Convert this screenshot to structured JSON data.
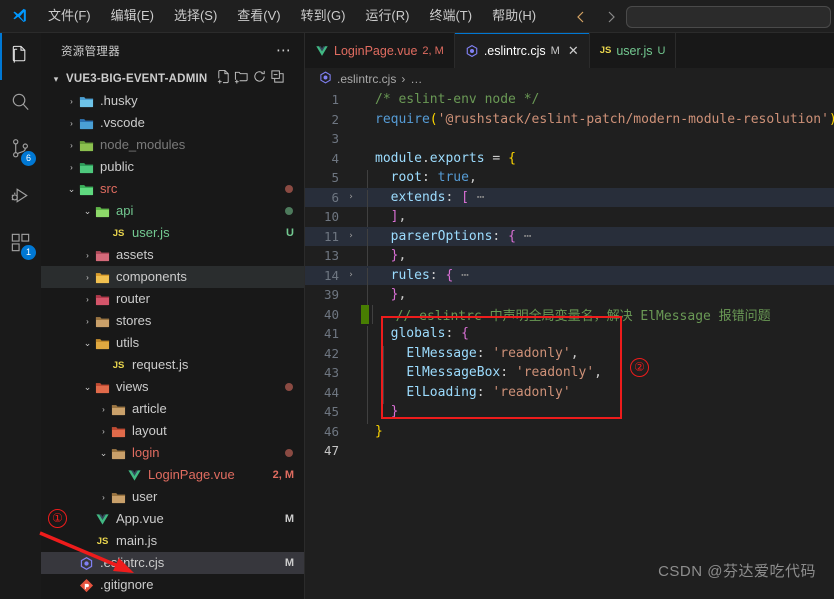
{
  "window": {
    "menu": [
      {
        "label": "文件(F)"
      },
      {
        "label": "编辑(E)"
      },
      {
        "label": "选择(S)"
      },
      {
        "label": "查看(V)"
      },
      {
        "label": "转到(G)"
      },
      {
        "label": "运行(R)"
      },
      {
        "label": "终端(T)"
      },
      {
        "label": "帮助(H)"
      }
    ],
    "command_center_placeholder": ""
  },
  "activity_bar": {
    "items": [
      {
        "name": "explorer",
        "icon": "files-icon",
        "badge": "",
        "active": true
      },
      {
        "name": "search",
        "icon": "search-icon",
        "badge": "",
        "active": false
      },
      {
        "name": "source-control",
        "icon": "source-control-icon",
        "badge": "6",
        "active": false
      },
      {
        "name": "run-debug",
        "icon": "run-debug-icon",
        "badge": "",
        "active": false
      },
      {
        "name": "extensions",
        "icon": "extensions-icon",
        "badge": "1",
        "active": false
      }
    ]
  },
  "sidebar": {
    "title": "资源管理器",
    "root": {
      "label": "VUE3-BIG-EVENT-ADMIN",
      "actions": [
        "new-file-icon",
        "new-folder-icon",
        "refresh-icon",
        "collapse-all-icon"
      ]
    },
    "tree": [
      {
        "label": ".husky",
        "indent": 1,
        "type": "folder",
        "chev": "collapsed",
        "icon": "husky",
        "color": "#cccccc",
        "mark": "",
        "dot": ""
      },
      {
        "label": ".vscode",
        "indent": 1,
        "type": "folder",
        "chev": "collapsed",
        "icon": "vscode",
        "color": "#cccccc",
        "mark": "",
        "dot": ""
      },
      {
        "label": "node_modules",
        "indent": 1,
        "type": "folder",
        "chev": "collapsed",
        "icon": "node",
        "color": "#7a7a7a",
        "mark": "",
        "dot": ""
      },
      {
        "label": "public",
        "indent": 1,
        "type": "folder",
        "chev": "collapsed",
        "icon": "public",
        "color": "#cccccc",
        "mark": "",
        "dot": ""
      },
      {
        "label": "src",
        "indent": 1,
        "type": "folder",
        "chev": "expanded",
        "icon": "src",
        "color": "#e06c60",
        "mark": "",
        "dot": "#8a4a42"
      },
      {
        "label": "api",
        "indent": 2,
        "type": "folder",
        "chev": "expanded",
        "icon": "api",
        "color": "#73c991",
        "mark": "",
        "dot": "#4d7a5c"
      },
      {
        "label": "user.js",
        "indent": 3,
        "type": "js",
        "chev": "none",
        "icon": "js",
        "color": "#73c991",
        "mark": "U",
        "markColor": "#73c991",
        "dot": ""
      },
      {
        "label": "assets",
        "indent": 2,
        "type": "folder",
        "chev": "collapsed",
        "icon": "assets",
        "color": "#cccccc",
        "mark": "",
        "dot": ""
      },
      {
        "label": "components",
        "indent": 2,
        "type": "folder",
        "chev": "collapsed",
        "icon": "components",
        "color": "#cccccc",
        "mark": "",
        "dot": "",
        "state": "hovered"
      },
      {
        "label": "router",
        "indent": 2,
        "type": "folder",
        "chev": "collapsed",
        "icon": "router",
        "color": "#cccccc",
        "mark": "",
        "dot": ""
      },
      {
        "label": "stores",
        "indent": 2,
        "type": "folder",
        "chev": "collapsed",
        "icon": "plain",
        "color": "#cccccc",
        "mark": "",
        "dot": ""
      },
      {
        "label": "utils",
        "indent": 2,
        "type": "folder",
        "chev": "expanded",
        "icon": "utils",
        "color": "#cccccc",
        "mark": "",
        "dot": ""
      },
      {
        "label": "request.js",
        "indent": 3,
        "type": "js",
        "chev": "none",
        "icon": "js",
        "color": "#cccccc",
        "mark": "",
        "dot": ""
      },
      {
        "label": "views",
        "indent": 2,
        "type": "folder",
        "chev": "expanded",
        "icon": "views",
        "color": "#cccccc",
        "mark": "",
        "dot": "#8a4a42"
      },
      {
        "label": "article",
        "indent": 3,
        "type": "folder",
        "chev": "collapsed",
        "icon": "plain",
        "color": "#cccccc",
        "mark": "",
        "dot": ""
      },
      {
        "label": "layout",
        "indent": 3,
        "type": "folder",
        "chev": "collapsed",
        "icon": "views",
        "color": "#cccccc",
        "mark": "",
        "dot": ""
      },
      {
        "label": "login",
        "indent": 3,
        "type": "folder",
        "chev": "expanded",
        "icon": "plain",
        "color": "#e06c60",
        "mark": "",
        "dot": "#8a4a42"
      },
      {
        "label": "LoginPage.vue",
        "indent": 4,
        "type": "vue",
        "chev": "none",
        "icon": "vue",
        "color": "#e06c60",
        "mark": "2, M",
        "markColor": "#e06c60",
        "dot": ""
      },
      {
        "label": "user",
        "indent": 3,
        "type": "folder",
        "chev": "collapsed",
        "icon": "plain",
        "color": "#cccccc",
        "mark": "",
        "dot": ""
      },
      {
        "label": "App.vue",
        "indent": 2,
        "type": "vue",
        "chev": "none",
        "icon": "vue",
        "color": "#cccccc",
        "mark": "M",
        "markColor": "#cccccc",
        "dot": ""
      },
      {
        "label": "main.js",
        "indent": 2,
        "type": "js",
        "chev": "none",
        "icon": "js",
        "color": "#cccccc",
        "mark": "",
        "dot": ""
      },
      {
        "label": ".eslintrc.cjs",
        "indent": 1,
        "type": "eslint",
        "chev": "none",
        "icon": "eslint",
        "color": "#cccccc",
        "mark": "M",
        "markColor": "#cccccc",
        "dot": "",
        "state": "selected"
      },
      {
        "label": ".gitignore",
        "indent": 1,
        "type": "git",
        "chev": "none",
        "icon": "git",
        "color": "#cccccc",
        "mark": "",
        "dot": ""
      }
    ]
  },
  "tabs": [
    {
      "label": "LoginPage.vue",
      "icon": "vue-icon",
      "mark": "2, M",
      "active": false,
      "closable": false,
      "color": "#e06c60"
    },
    {
      "label": ".eslintrc.cjs",
      "icon": "eslint-icon",
      "mark": "M",
      "active": true,
      "closable": true,
      "color": "#ffffff"
    },
    {
      "label": "user.js",
      "icon": "js-icon",
      "mark": "U",
      "active": false,
      "closable": false,
      "color": "#73c991"
    }
  ],
  "breadcrumb": {
    "icon": "eslint-icon",
    "file": ".eslintrc.cjs",
    "separator": "›",
    "more": "…"
  },
  "editor": {
    "lines": [
      {
        "num": "1",
        "fold": "",
        "modified": false,
        "folded": false,
        "indent": 0,
        "tokens": [
          {
            "t": "/* eslint-env node */",
            "c": "t-comment"
          }
        ]
      },
      {
        "num": "2",
        "fold": "",
        "modified": false,
        "folded": false,
        "indent": 0,
        "tokens": [
          {
            "t": "require",
            "c": "t-fn"
          },
          {
            "t": "(",
            "c": "t-paren"
          },
          {
            "t": "'@rushstack/eslint-patch/modern-module-resolution'",
            "c": "t-str"
          },
          {
            "t": ")",
            "c": "t-paren"
          }
        ]
      },
      {
        "num": "3",
        "fold": "",
        "modified": false,
        "folded": false,
        "indent": 0,
        "tokens": []
      },
      {
        "num": "4",
        "fold": "",
        "modified": false,
        "folded": false,
        "indent": 0,
        "tokens": [
          {
            "t": "module",
            "c": "t-obj"
          },
          {
            "t": ".",
            "c": "t-punct"
          },
          {
            "t": "exports",
            "c": "t-obj"
          },
          {
            "t": " = ",
            "c": "t-punct"
          },
          {
            "t": "{",
            "c": "t-paren"
          }
        ]
      },
      {
        "num": "5",
        "fold": "",
        "modified": false,
        "folded": false,
        "indent": 1,
        "tokens": [
          {
            "t": "  ",
            "c": ""
          },
          {
            "t": "root",
            "c": "t-prop"
          },
          {
            "t": ": ",
            "c": "t-punct"
          },
          {
            "t": "true",
            "c": "t-kw"
          },
          {
            "t": ",",
            "c": "t-punct"
          }
        ]
      },
      {
        "num": "6",
        "fold": "›",
        "modified": false,
        "folded": true,
        "indent": 1,
        "tokens": [
          {
            "t": "  ",
            "c": ""
          },
          {
            "t": "extends",
            "c": "t-prop"
          },
          {
            "t": ": ",
            "c": "t-punct"
          },
          {
            "t": "[",
            "c": "t-paren2"
          },
          {
            "t": " ⋯",
            "c": "t-dots"
          }
        ]
      },
      {
        "num": "10",
        "fold": "",
        "modified": false,
        "folded": false,
        "indent": 1,
        "tokens": [
          {
            "t": "  ",
            "c": ""
          },
          {
            "t": "]",
            "c": "t-paren2"
          },
          {
            "t": ",",
            "c": "t-punct"
          }
        ]
      },
      {
        "num": "11",
        "fold": "›",
        "modified": false,
        "folded": true,
        "indent": 1,
        "tokens": [
          {
            "t": "  ",
            "c": ""
          },
          {
            "t": "parserOptions",
            "c": "t-prop"
          },
          {
            "t": ": ",
            "c": "t-punct"
          },
          {
            "t": "{",
            "c": "t-paren2"
          },
          {
            "t": " ⋯",
            "c": "t-dots"
          }
        ]
      },
      {
        "num": "13",
        "fold": "",
        "modified": false,
        "folded": false,
        "indent": 1,
        "tokens": [
          {
            "t": "  ",
            "c": ""
          },
          {
            "t": "}",
            "c": "t-paren2"
          },
          {
            "t": ",",
            "c": "t-punct"
          }
        ]
      },
      {
        "num": "14",
        "fold": "›",
        "modified": false,
        "folded": true,
        "indent": 1,
        "tokens": [
          {
            "t": "  ",
            "c": ""
          },
          {
            "t": "rules",
            "c": "t-prop"
          },
          {
            "t": ": ",
            "c": "t-punct"
          },
          {
            "t": "{",
            "c": "t-paren2"
          },
          {
            "t": " ⋯",
            "c": "t-dots"
          }
        ]
      },
      {
        "num": "39",
        "fold": "",
        "modified": false,
        "folded": false,
        "indent": 1,
        "tokens": [
          {
            "t": "  ",
            "c": ""
          },
          {
            "t": "}",
            "c": "t-paren2"
          },
          {
            "t": ",",
            "c": "t-punct"
          }
        ]
      },
      {
        "num": "40",
        "fold": "",
        "modified": true,
        "folded": false,
        "indent": 1,
        "tokens": [
          {
            "t": "  ",
            "c": ""
          },
          {
            "t": "// eslintrc 中声明全局变量名，解决 ElMessage 报错问题",
            "c": "t-comment"
          }
        ]
      },
      {
        "num": "41",
        "fold": "",
        "modified": false,
        "folded": false,
        "indent": 1,
        "tokens": [
          {
            "t": "  ",
            "c": ""
          },
          {
            "t": "globals",
            "c": "t-prop"
          },
          {
            "t": ": ",
            "c": "t-punct"
          },
          {
            "t": "{",
            "c": "t-paren2"
          }
        ]
      },
      {
        "num": "42",
        "fold": "",
        "modified": false,
        "folded": false,
        "indent": 2,
        "tokens": [
          {
            "t": "    ",
            "c": ""
          },
          {
            "t": "ElMessage",
            "c": "t-prop"
          },
          {
            "t": ": ",
            "c": "t-punct"
          },
          {
            "t": "'readonly'",
            "c": "t-str"
          },
          {
            "t": ",",
            "c": "t-punct"
          }
        ]
      },
      {
        "num": "43",
        "fold": "",
        "modified": false,
        "folded": false,
        "indent": 2,
        "tokens": [
          {
            "t": "    ",
            "c": ""
          },
          {
            "t": "ElMessageBox",
            "c": "t-prop"
          },
          {
            "t": ": ",
            "c": "t-punct"
          },
          {
            "t": "'readonly'",
            "c": "t-str"
          },
          {
            "t": ",",
            "c": "t-punct"
          }
        ]
      },
      {
        "num": "44",
        "fold": "",
        "modified": false,
        "folded": false,
        "indent": 2,
        "tokens": [
          {
            "t": "    ",
            "c": ""
          },
          {
            "t": "ElLoading",
            "c": "t-prop"
          },
          {
            "t": ": ",
            "c": "t-punct"
          },
          {
            "t": "'readonly'",
            "c": "t-str"
          }
        ]
      },
      {
        "num": "45",
        "fold": "",
        "modified": false,
        "folded": false,
        "indent": 1,
        "tokens": [
          {
            "t": "  ",
            "c": ""
          },
          {
            "t": "}",
            "c": "t-paren2"
          }
        ]
      },
      {
        "num": "46",
        "fold": "",
        "modified": false,
        "folded": false,
        "indent": 0,
        "tokens": [
          {
            "t": "}",
            "c": "t-paren"
          }
        ]
      },
      {
        "num": "47",
        "fold": "",
        "modified": false,
        "folded": false,
        "indent": 0,
        "tokens": []
      }
    ]
  },
  "annotations": {
    "marker_one": "①",
    "marker_two": "②",
    "redbox_color": "#ee1c1c"
  },
  "watermark": "CSDN @芬达爱吃代码"
}
